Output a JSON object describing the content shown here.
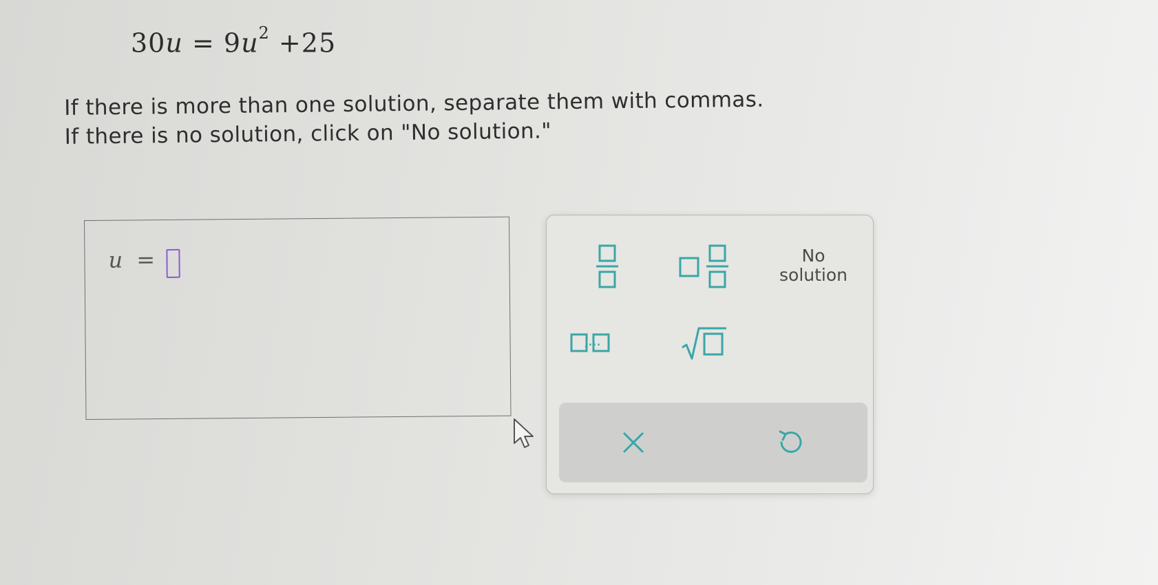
{
  "problem": {
    "equation_left_coef": "30",
    "equation_var": "u",
    "equation_equals": "=",
    "equation_right_coef": "9",
    "equation_exponent": "2",
    "equation_tail": "+25",
    "instruction_line1": "If there is more than one solution, separate them with commas.",
    "instruction_line2": "If there is no solution, click on \"No solution.\""
  },
  "answer": {
    "variable": "u",
    "equals": "=",
    "value": ""
  },
  "keypad": {
    "no_solution_line1": "No",
    "no_solution_line2": "solution",
    "list_suffix": ",...",
    "accent_color": "#3aa6a6"
  }
}
